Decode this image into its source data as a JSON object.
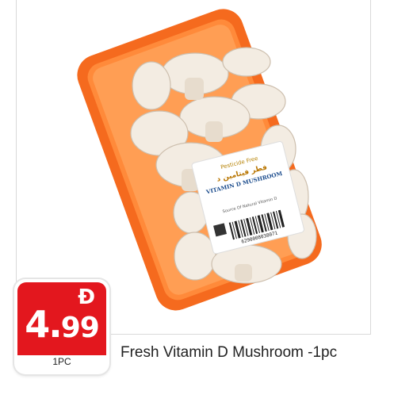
{
  "product": {
    "title": "Fresh Vitamin D Mushroom -1pc",
    "image_label": "Fresh Vitamin D Mushroom -1pc"
  },
  "price": {
    "currency_symbol": "Đ",
    "integer": "4.",
    "decimal": "99",
    "unit": "1PC",
    "badge_color": "#e3171e"
  },
  "package_label": {
    "arabic_title": "فطر فيتامين د",
    "english_title": "VITAMIN D MUSHROOM",
    "tag": "Pesticide Free",
    "claim": "Source Of Natural Vitamin D",
    "barcode": "6290008038071"
  },
  "colors": {
    "tray": "#f56a1e",
    "tray_inner": "#ff8a3a"
  }
}
